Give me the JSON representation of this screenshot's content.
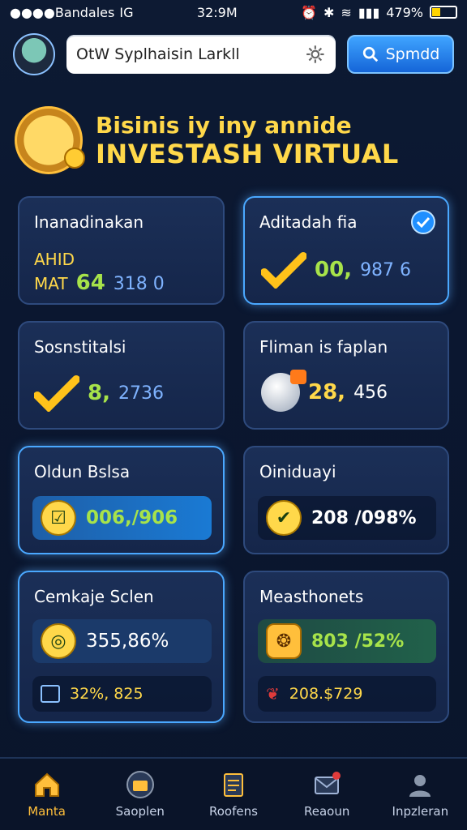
{
  "status_bar": {
    "carrier": "●●●●Bandales",
    "network": "IG",
    "time": "32:9M",
    "battery_percent": "479%"
  },
  "header": {
    "search_text": "OtW Syplhaisin Larkll",
    "search_button_label": "Spmdd"
  },
  "hero": {
    "title_line1": "Bisinis iy iny annide",
    "title_line2": "INVESTASH VIRTUAL"
  },
  "cards": [
    {
      "title": "Inanadinakan",
      "sub1": "AHID",
      "sub2": "MAT",
      "value_main": "64",
      "value_sub": "318 0"
    },
    {
      "title": "Aditadah fia",
      "value_main": "00,",
      "value_sub": "987 6"
    },
    {
      "title": "Sosnstitalsi",
      "value_main": "8,",
      "value_sub": "2736"
    },
    {
      "title": "Fliman is faplan",
      "value_main": "28,",
      "value_sub": "456"
    },
    {
      "title": "Oldun Bslsa",
      "value_main": "006,/906"
    },
    {
      "title": "Oiniduayi",
      "value_main": "208 /098%"
    },
    {
      "title": "Cemkaje Sclen",
      "value_main": "355,86%",
      "value_sub": "32%, 825"
    },
    {
      "title": "Measthonets",
      "value_main": "803 /52%",
      "value_sub": "208.$729"
    }
  ],
  "bottom_nav": [
    {
      "label": "Manta",
      "active": true
    },
    {
      "label": "Saoplen"
    },
    {
      "label": "Roofens"
    },
    {
      "label": "Reaoun"
    },
    {
      "label": "Inpzleran"
    }
  ],
  "colors": {
    "accent_yellow": "#ffd84a",
    "accent_green": "#a7e34a",
    "accent_blue": "#3fa4ff",
    "background": "#0d1a33"
  }
}
